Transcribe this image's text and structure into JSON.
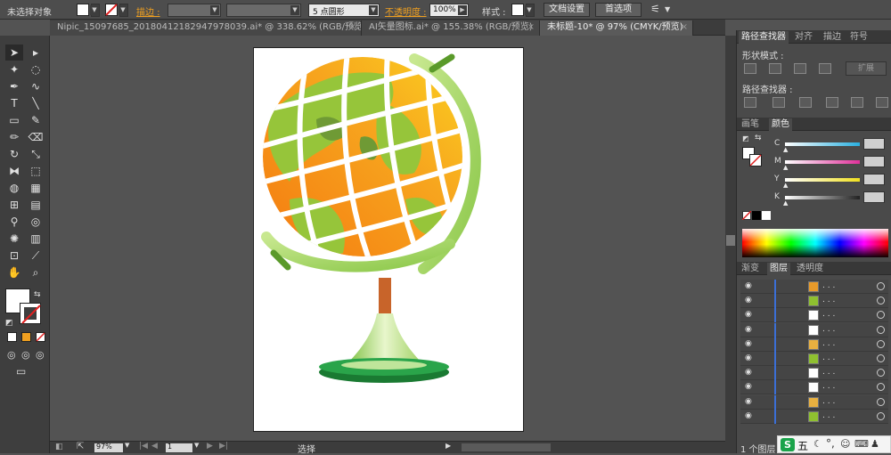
{
  "control_bar": {
    "selection_label": "未选择对象",
    "stroke_label": "描边 :",
    "brush_label": "5 点圆形",
    "opacity_label": "不透明度 :",
    "opacity_value": "100%",
    "style_label": "样式 :",
    "doc_settings": "文档设置",
    "preferences": "首选项"
  },
  "tabs": [
    {
      "label": "Nipic_15097685_20180412182947978039.ai* @ 338.62% (RGB/预览)"
    },
    {
      "label": "AI矢量图标.ai* @ 155.38% (RGB/预览)"
    },
    {
      "label": "未标题-10* @ 97% (CMYK/预览)"
    }
  ],
  "tools": [
    "selection-tool",
    "direct-selection-tool",
    "magic-wand-tool",
    "lasso-tool",
    "pen-tool",
    "curvature-tool",
    "type-tool",
    "line-tool",
    "rectangle-tool",
    "paintbrush-tool",
    "pencil-tool",
    "eraser-tool",
    "rotate-tool",
    "scale-tool",
    "width-tool",
    "free-transform-tool",
    "shape-builder-tool",
    "perspective-grid-tool",
    "mesh-tool",
    "gradient-tool",
    "eyedropper-tool",
    "blend-tool",
    "symbol-sprayer-tool",
    "column-graph-tool",
    "artboard-tool",
    "slice-tool",
    "hand-tool",
    "zoom-tool"
  ],
  "pathfinder_panel": {
    "tabs": [
      "路径查找器",
      "对齐",
      "描边",
      "符号"
    ],
    "shape_modes_label": "形状模式 :",
    "expand_label": "扩展",
    "pathfinders_label": "路径查找器 :"
  },
  "color_panel": {
    "tabs": [
      "画笔",
      "颜色"
    ],
    "channels": [
      {
        "label": "C",
        "color": "#2ab0e0"
      },
      {
        "label": "M",
        "color": "#e0309a"
      },
      {
        "label": "Y",
        "color": "#f0e020"
      },
      {
        "label": "K",
        "color": "#222222"
      }
    ]
  },
  "layers_panel": {
    "tabs": [
      "渐变",
      "图层",
      "透明度"
    ],
    "rows": [
      {
        "thumb": "#e89a2a",
        "dots": ". . ."
      },
      {
        "thumb": "#8fc030",
        "dots": ". . ."
      },
      {
        "thumb": "#ffffff",
        "dots": ". . ."
      },
      {
        "thumb": "#ffffff",
        "dots": ". . ."
      },
      {
        "thumb": "#e8b040",
        "dots": ". . ."
      },
      {
        "thumb": "#8fc030",
        "dots": ". . ."
      },
      {
        "thumb": "#ffffff",
        "dots": ". . ."
      },
      {
        "thumb": "#ffffff",
        "dots": ". . ."
      },
      {
        "thumb": "#e8b040",
        "dots": ". . ."
      },
      {
        "thumb": "#8fc030",
        "dots": ". . ."
      }
    ],
    "footer": "1 个图层"
  },
  "status_bar": {
    "zoom": "97%",
    "artboard": "1",
    "mode": "选择"
  },
  "ime": {
    "label": "五"
  }
}
